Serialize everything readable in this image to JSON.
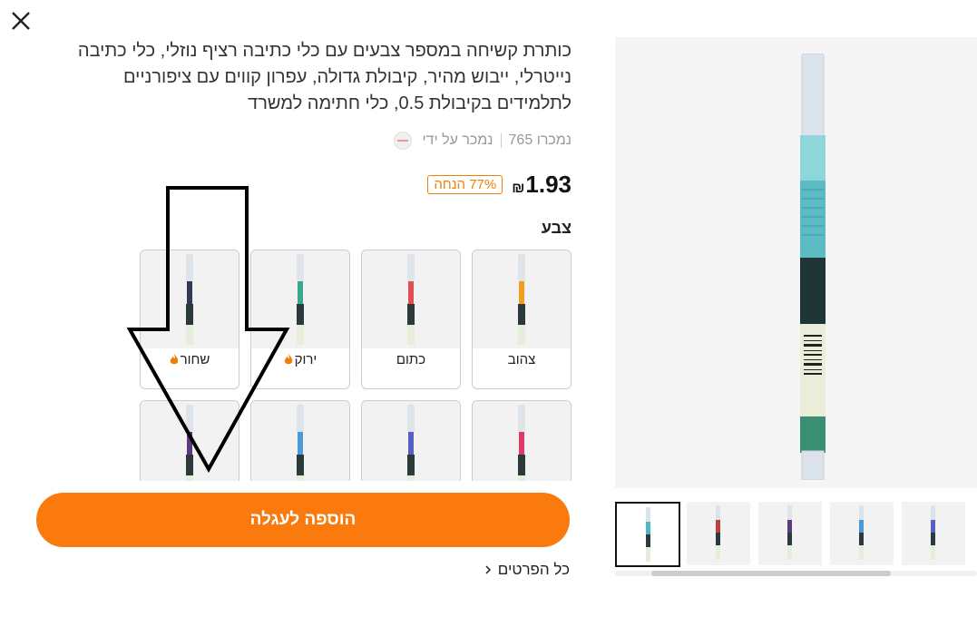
{
  "dialog": {
    "close_label": "close"
  },
  "product": {
    "title": "כותרת קשיחה במספר צבעים עם כלי כתיבה רציף נוזלי, כלי כתיבה נייטרלי, ייבוש מהיר, קיבולת גדולה, עפרון קווים עם ציפורניים לתלמידים בקיבולת 0.5, כלי חתימה למשרד",
    "sold_count": "נמכרו 765",
    "sold_by": "נמכר על ידי",
    "price_value": "1.93",
    "currency": "₪",
    "discount": "77% הנחה"
  },
  "color_section": {
    "label": "צבע",
    "swatches": [
      {
        "name": "צהוב",
        "hot": false,
        "ink": "#f0a020"
      },
      {
        "name": "כתום",
        "hot": false,
        "ink": "#e05050"
      },
      {
        "name": "ירוק",
        "hot": true,
        "ink": "#3aa890"
      },
      {
        "name": "שחור",
        "hot": true,
        "ink": "#333a55"
      },
      {
        "name": "",
        "hot": false,
        "ink": "#e03a6a"
      },
      {
        "name": "",
        "hot": false,
        "ink": "#5560c0"
      },
      {
        "name": "",
        "hot": false,
        "ink": "#4a9ad8"
      },
      {
        "name": "",
        "hot": false,
        "ink": "#5a3a80"
      }
    ]
  },
  "actions": {
    "add_to_cart": "הוספה לעגלה",
    "all_details": "כל הפרטים"
  },
  "gallery": {
    "main_ink": "#49b8c8",
    "thumbnails": [
      {
        "ink": "#49b8c8",
        "selected": true
      },
      {
        "ink": "#c04040",
        "selected": false
      },
      {
        "ink": "#5a3a80",
        "selected": false
      },
      {
        "ink": "#4a9ad8",
        "selected": false
      },
      {
        "ink": "#5560c0",
        "selected": false
      }
    ]
  },
  "colors": {
    "accent": "#fa7a0e",
    "flame": "#f07e0a"
  }
}
